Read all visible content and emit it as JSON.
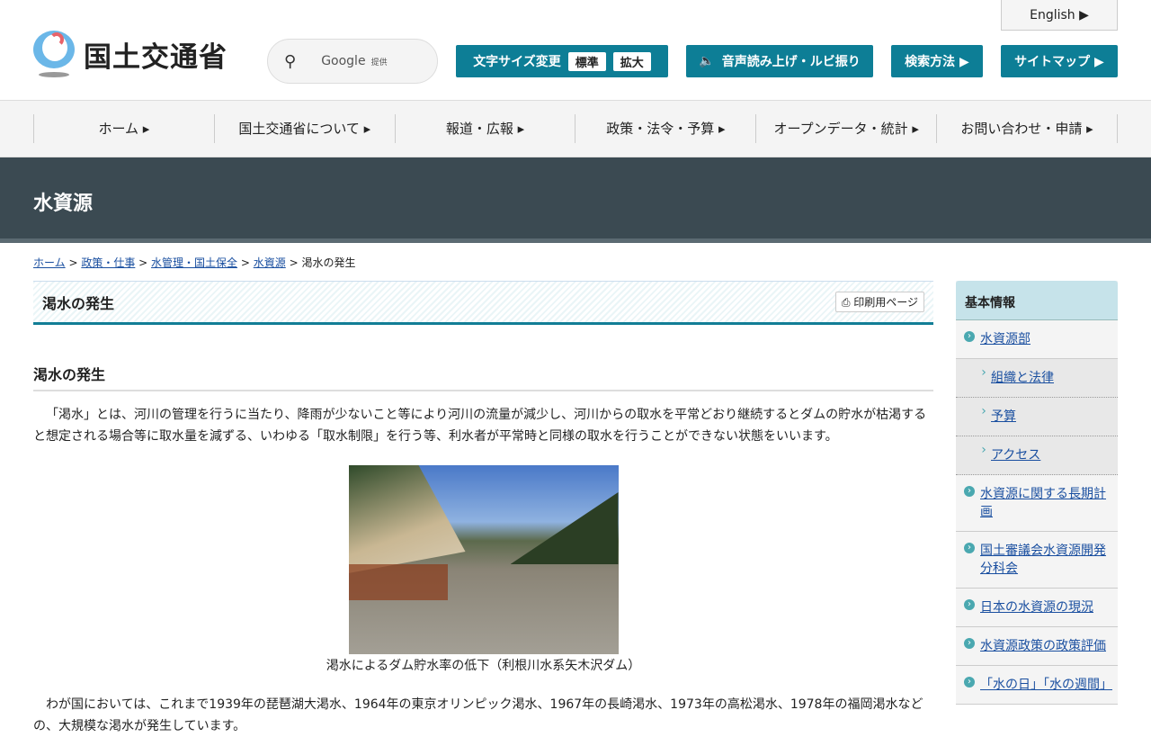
{
  "header": {
    "logo_text": "国土交通省",
    "search_brand": "Google",
    "search_provided": "提供",
    "font_size_label": "文字サイズ変更",
    "font_standard": "標準",
    "font_large": "拡大",
    "speech": "音声読み上げ・ルビ振り",
    "search_method": "検索方法 ▶",
    "sitemap": "サイトマップ ▶",
    "english": "English ▶"
  },
  "nav": [
    "ホーム ▸",
    "国土交通省について ▸",
    "報道・広報 ▸",
    "政策・法令・予算 ▸",
    "オープンデータ・統計 ▸",
    "お問い合わせ・申請 ▸"
  ],
  "banner": "水資源",
  "breadcrumb": [
    "ホーム",
    "政策・仕事",
    "水管理・国土保全",
    "水資源",
    "渇水の発生"
  ],
  "main": {
    "page_title": "渇水の発生",
    "print_label": "印刷用ページ",
    "heading": "渇水の発生",
    "para1": "「渇水」とは、河川の管理を行うに当たり、降雨が少ないこと等により河川の流量が減少し、河川からの取水を平常どおり継続するとダムの貯水が枯渇すると想定される場合等に取水量を減ずる、いわゆる「取水制限」を行う等、利水者が平常時と同様の取水を行うことができない状態をいいます。",
    "caption": "渇水によるダム貯水率の低下（利根川水系矢木沢ダム）",
    "para2": "わが国においては、これまで1939年の琵琶湖大渇水、1964年の東京オリンピック渇水、1967年の長崎渇水、1973年の高松渇水、1978年の福岡渇水などの、大規模な渇水が発生しています。"
  },
  "sidebar": {
    "title": "基本情報",
    "items": [
      {
        "label": "水資源部",
        "sub": false
      },
      {
        "label": "組織と法律",
        "sub": true
      },
      {
        "label": "予算",
        "sub": true
      },
      {
        "label": "アクセス",
        "sub": true
      },
      {
        "label": "水資源に関する長期計画",
        "sub": false
      },
      {
        "label": "国土審議会水資源開発分科会",
        "sub": false
      },
      {
        "label": "日本の水資源の現況",
        "sub": false
      },
      {
        "label": "水資源政策の政策評価",
        "sub": false
      },
      {
        "label": "「水の日」「水の週間」",
        "sub": false
      }
    ]
  }
}
